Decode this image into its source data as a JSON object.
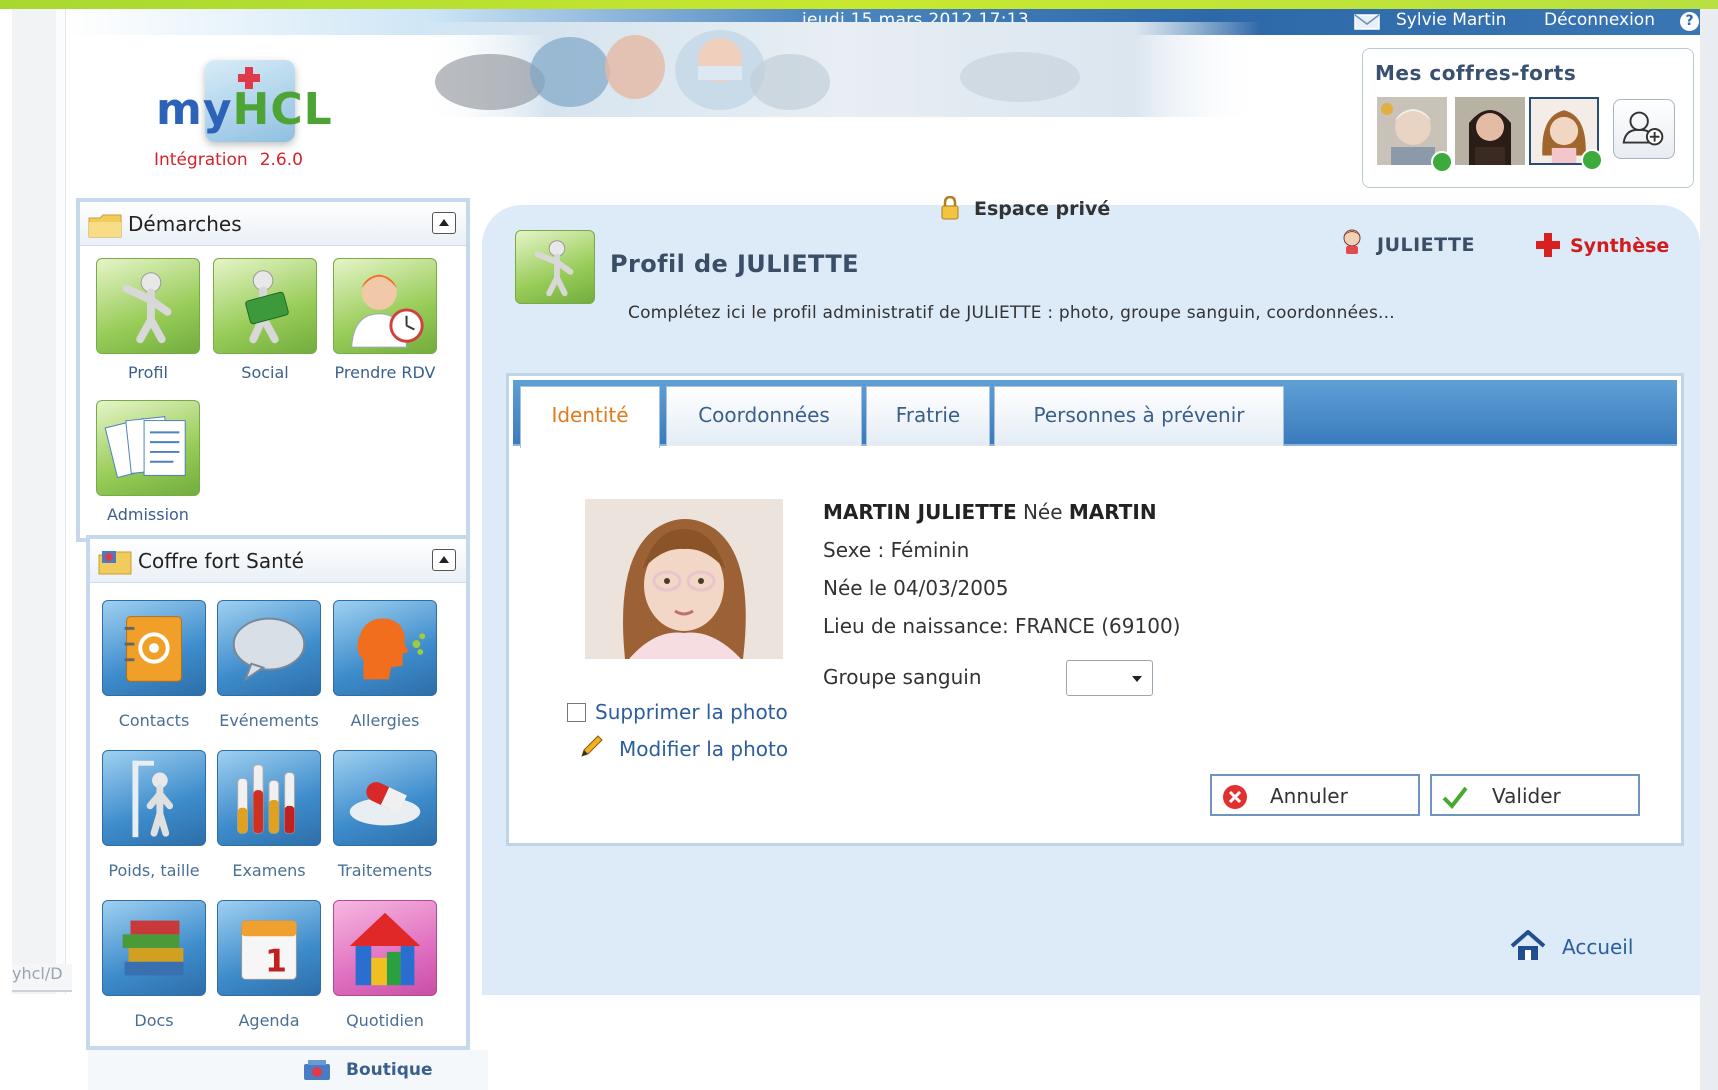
{
  "header": {
    "datetime": "jeudi 15 mars 2012 17:13",
    "user_name": "Sylvie Martin",
    "logout_label": "Déconnexion",
    "help_label": "?"
  },
  "logo": {
    "my": "my",
    "hcl": "HCL",
    "env": "Intégration",
    "version": "2.6.0"
  },
  "coffres": {
    "title": "Mes coffres-forts"
  },
  "sidebar": {
    "demarches": {
      "title": "Démarches",
      "items": [
        {
          "label": "Profil",
          "icon": "profile-figure-icon"
        },
        {
          "label": "Social",
          "icon": "social-card-icon"
        },
        {
          "label": "Prendre RDV",
          "icon": "appointment-clock-icon"
        },
        {
          "label": "Admission",
          "icon": "admission-documents-icon"
        }
      ]
    },
    "coffre_sante": {
      "title": "Coffre fort Santé",
      "items": [
        {
          "label": "Contacts",
          "icon": "contacts-book-icon"
        },
        {
          "label": "Evénements",
          "icon": "events-bubble-icon"
        },
        {
          "label": "Allergies",
          "icon": "allergies-head-icon"
        },
        {
          "label": "Poids, taille",
          "icon": "weight-height-icon"
        },
        {
          "label": "Examens",
          "icon": "exams-tubes-icon"
        },
        {
          "label": "Traitements",
          "icon": "treatments-pill-icon"
        },
        {
          "label": "Docs",
          "icon": "docs-books-icon"
        },
        {
          "label": "Agenda",
          "icon": "agenda-calendar-icon"
        },
        {
          "label": "Quotidien",
          "icon": "daily-house-icon"
        }
      ]
    },
    "boutique_label": "Boutique",
    "url_fragment": "yhcl/D"
  },
  "main": {
    "space_label": "Espace privé",
    "profile_title": "Profil de JULIETTE",
    "patient_label": "JULIETTE",
    "synthese_label": "Synthèse",
    "description": "Complétez ici le profil administratif de JULIETTE : photo, groupe sanguin, coordonnées..."
  },
  "tabs": [
    {
      "label": "Identité",
      "active": true
    },
    {
      "label": "Coordonnées",
      "active": false
    },
    {
      "label": "Fratrie",
      "active": false
    },
    {
      "label": "Personnes à prévenir",
      "active": false
    }
  ],
  "identity": {
    "name": "MARTIN JULIETTE",
    "nee_label": "Née",
    "birth_name": "MARTIN",
    "sexe": "Sexe : Féminin",
    "birth_date": "Née le 04/03/2005",
    "birth_place": "Lieu de naissance: FRANCE (69100)",
    "blood_group_label": "Groupe sanguin",
    "blood_group_value": "",
    "delete_photo_label": "Supprimer la photo",
    "edit_photo_label": "Modifier la photo"
  },
  "actions": {
    "cancel_label": "Annuler",
    "validate_label": "Valider"
  },
  "footer": {
    "home_label": "Accueil"
  },
  "colors": {
    "accent_blue": "#3a7bbd",
    "active_tab_orange": "#e07a1a",
    "synthese_red": "#d01c1c",
    "logo_blue": "#2c62b8",
    "logo_green": "#4ea335",
    "tile_green": "#98cc58",
    "tile_blue": "#3e8ccc"
  }
}
